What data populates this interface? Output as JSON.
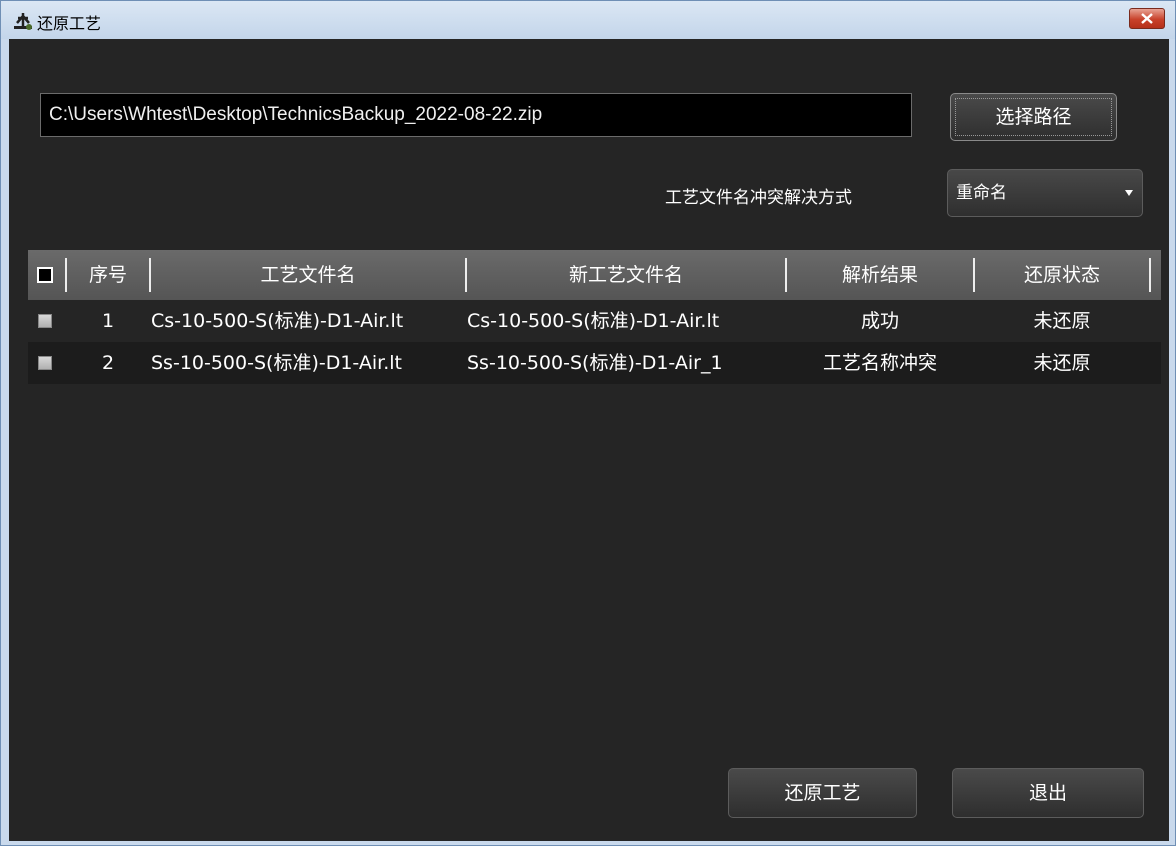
{
  "window": {
    "title": "还原工艺"
  },
  "path": {
    "value": "C:\\Users\\Whtest\\Desktop\\TechnicsBackup_2022-08-22.zip",
    "choose_label": "选择路径"
  },
  "conflict": {
    "label": "工艺文件名冲突解决方式",
    "selected": "重命名"
  },
  "table": {
    "columns": [
      "序号",
      "工艺文件名",
      "新工艺文件名",
      "解析结果",
      "还原状态"
    ],
    "rows": [
      {
        "index": "1",
        "file": "Cs-10-500-S(标准)-D1-Air.lt",
        "new_file": "Cs-10-500-S(标准)-D1-Air.lt",
        "result": "成功",
        "status": "未还原"
      },
      {
        "index": "2",
        "file": "Ss-10-500-S(标准)-D1-Air.lt",
        "new_file": "Ss-10-500-S(标准)-D1-Air_1",
        "result": "工艺名称冲突",
        "status": "未还原"
      }
    ]
  },
  "footer": {
    "restore_label": "还原工艺",
    "exit_label": "退出"
  },
  "colors": {
    "background": "#252525",
    "header": "#5f5f5f",
    "row_alt": "#1c1c1c",
    "titlebar": "#c9d9ec",
    "close": "#c8412a"
  }
}
